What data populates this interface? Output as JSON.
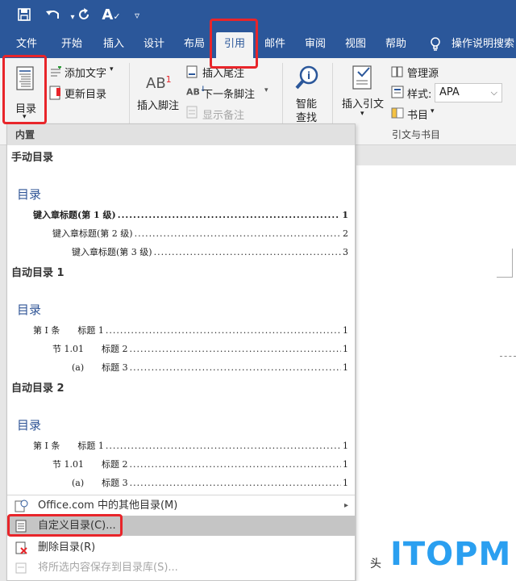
{
  "qat": {
    "save_icon": "save-icon",
    "undo_icon": "undo-icon",
    "redo_icon": "redo-icon",
    "format_icon": "spelling-icon",
    "customize_icon": "chevron-down-icon"
  },
  "tabs": [
    "文件",
    "开始",
    "插入",
    "设计",
    "布局",
    "引用",
    "邮件",
    "审阅",
    "视图",
    "帮助"
  ],
  "active_tab": "引用",
  "tell_me": "操作说明搜索",
  "ribbon": {
    "toc_button": "目录",
    "add_text": "添加文字",
    "update_toc": "更新目录",
    "insert_footnote": "插入脚注",
    "footnote_ab": "AB",
    "footnote_sup": "1",
    "insert_endnote": "插入尾注",
    "next_footnote": "下一条脚注",
    "show_notes": "显示备注",
    "smart_lookup_1": "智能",
    "smart_lookup_2": "查找",
    "insert_citation": "插入引文",
    "manage_sources": "管理源",
    "style_label": "样式:",
    "style_value": "APA",
    "bibliography": "书目",
    "group_citations": "引文与书目"
  },
  "menu": {
    "header": "内置",
    "manual_title": "手动目录",
    "manual_heading": "目录",
    "manual_rows": [
      {
        "label": "键入章标题(第 1 级)",
        "page": "1"
      },
      {
        "label": "键入章标题(第 2 级)",
        "page": "2"
      },
      {
        "label": "键入章标题(第 3 级)",
        "page": "3"
      }
    ],
    "auto1_title": "自动目录 1",
    "auto1_heading": "目录",
    "auto1_rows": [
      {
        "label": "第 I 条　　标题 1",
        "page": "1"
      },
      {
        "label": "节 1.01　　标题 2",
        "page": "1"
      },
      {
        "label": "(a)　　标题 3",
        "page": "1"
      }
    ],
    "auto2_title": "自动目录 2",
    "auto2_heading": "目录",
    "auto2_rows": [
      {
        "label": "第 I 条　　标题 1",
        "page": "1"
      },
      {
        "label": "节 1.01　　标题 2",
        "page": "1"
      },
      {
        "label": "(a)　　标题 3",
        "page": "1"
      }
    ],
    "item_office": "Office.com 中的其他目录(M)",
    "item_custom": "自定义目录(C)...",
    "item_delete": "删除目录(R)",
    "item_save": "将所选内容保存到目录库(S)..."
  },
  "document": {
    "partial_text": "头"
  },
  "watermark": "ITOPM",
  "colors": {
    "ribbon_blue": "#2b579a",
    "highlight_red": "#e8252a",
    "heading_blue": "#2f5496",
    "watermark": "#2a9ff0"
  }
}
